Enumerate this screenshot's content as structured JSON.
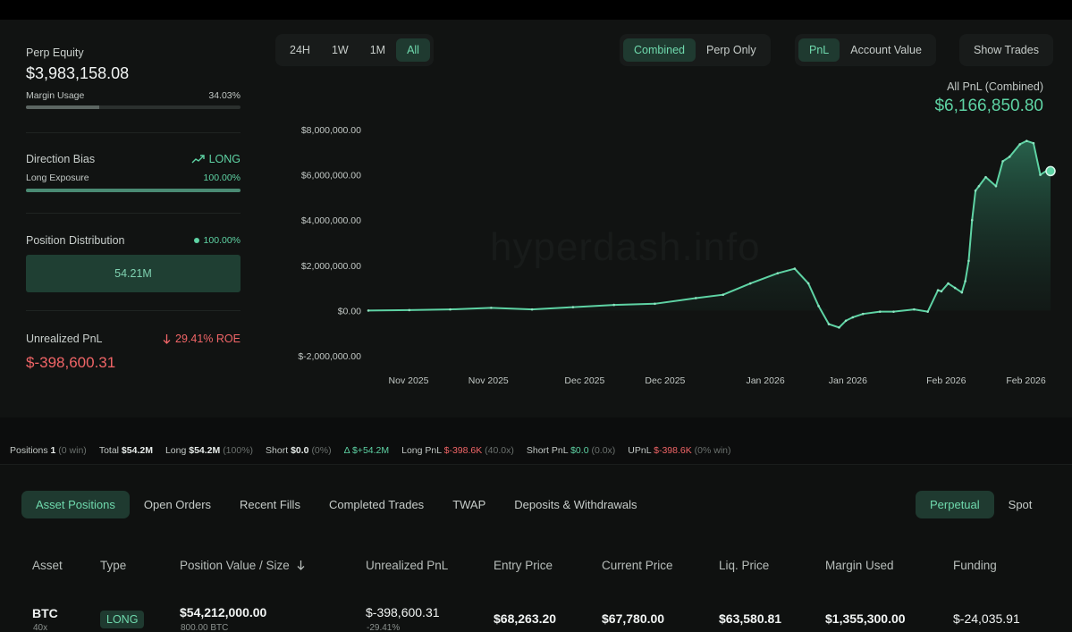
{
  "sidebar": {
    "perp_equity_label": "Perp Equity",
    "perp_equity_value": "$3,983,158.08",
    "margin_usage_label": "Margin Usage",
    "margin_usage_value": "34.03%",
    "margin_usage_fraction": 0.3403,
    "direction_bias_label": "Direction Bias",
    "direction_bias_value": "LONG",
    "long_exposure_label": "Long Exposure",
    "long_exposure_value": "100.00%",
    "long_exposure_fraction": 1.0,
    "position_distribution_label": "Position Distribution",
    "position_distribution_value": "100.00%",
    "position_distribution_amount": "54.21M",
    "unrealized_pnl_label": "Unrealized PnL",
    "unrealized_pnl_roe": "29.41% ROE",
    "unrealized_pnl_value": "$-398,600.31"
  },
  "range_tabs": [
    "24H",
    "1W",
    "1M",
    "All"
  ],
  "range_active": "All",
  "mode_tabs": [
    "Combined",
    "Perp Only"
  ],
  "mode_active": "Combined",
  "metric_tabs": [
    "PnL",
    "Account Value"
  ],
  "metric_active": "PnL",
  "show_trades_label": "Show Trades",
  "chart_header": {
    "label": "All PnL (Combined)",
    "value": "$6,166,850.80"
  },
  "watermark": "hyperdash.info",
  "chart_data": {
    "type": "area",
    "y_tick_labels": [
      "$8,000,000.00",
      "$6,000,000.00",
      "$4,000,000.00",
      "$2,000,000.00",
      "$0.00",
      "$-2,000,000.00"
    ],
    "y_ticks": [
      8000000,
      6000000,
      4000000,
      2000000,
      0,
      -2000000
    ],
    "ylim": [
      -2000000,
      8000000
    ],
    "x_tick_labels": [
      "Nov 2025",
      "Nov 2025",
      "Dec 2025",
      "Dec 2025",
      "Jan 2026",
      "Jan 2026",
      "Feb 2026",
      "Feb 2026"
    ],
    "x_ticks": [
      0.059,
      0.176,
      0.317,
      0.435,
      0.582,
      0.703,
      0.847,
      0.964
    ],
    "series": [
      {
        "x": [
          0,
          0.06,
          0.12,
          0.18,
          0.24,
          0.3,
          0.36,
          0.42,
          0.48,
          0.52,
          0.56,
          0.6,
          0.625,
          0.645,
          0.66,
          0.675,
          0.69,
          0.7,
          0.71,
          0.725,
          0.75,
          0.77,
          0.8,
          0.82,
          0.835,
          0.84,
          0.85,
          0.86,
          0.87,
          0.875,
          0.88,
          0.885,
          0.89,
          0.895,
          0.905,
          0.92,
          0.93,
          0.94,
          0.955,
          0.965,
          0.975,
          0.985,
          0.995,
          1.0
        ],
        "values": [
          0,
          20000,
          50000,
          120000,
          50000,
          150000,
          250000,
          300000,
          550000,
          700000,
          1200000,
          1650000,
          1850000,
          1200000,
          200000,
          -600000,
          -750000,
          -450000,
          -300000,
          -150000,
          -50000,
          -50000,
          50000,
          -50000,
          900000,
          850000,
          1200000,
          1000000,
          800000,
          1300000,
          2200000,
          4000000,
          5300000,
          5500000,
          5900000,
          5500000,
          6600000,
          6800000,
          7350000,
          7500000,
          7400000,
          6000000,
          6200000,
          6166850
        ]
      }
    ]
  },
  "stats_bar": {
    "positions_label": "Positions",
    "positions_count": "1",
    "positions_note": "(0 win)",
    "total_label": "Total",
    "total_value": "$54.2M",
    "long_label": "Long",
    "long_value": "$54.2M",
    "long_pct": "(100%)",
    "short_label": "Short",
    "short_value": "$0.0",
    "short_pct": "(0%)",
    "delta_label": "Δ",
    "delta_value": "$+54.2M",
    "long_pnl_label": "Long PnL",
    "long_pnl_value": "$-398.6K",
    "long_pnl_note": "(40.0x)",
    "short_pnl_label": "Short PnL",
    "short_pnl_value": "$0.0",
    "short_pnl_note": "(0.0x)",
    "upnl_label": "UPnL",
    "upnl_value": "$-398.6K",
    "upnl_note": "(0% win)"
  },
  "sub_tabs": [
    "Asset Positions",
    "Open Orders",
    "Recent Fills",
    "Completed Trades",
    "TWAP",
    "Deposits & Withdrawals"
  ],
  "sub_tab_active": "Asset Positions",
  "market_tabs": [
    "Perpetual",
    "Spot"
  ],
  "market_active": "Perpetual",
  "table": {
    "headers": [
      "Asset",
      "Type",
      "Position Value / Size",
      "Unrealized PnL",
      "Entry Price",
      "Current Price",
      "Liq. Price",
      "Margin Used",
      "Funding"
    ],
    "sort_icon": "arrow-down-icon",
    "row": {
      "asset": "BTC",
      "leverage": "40x",
      "type": "LONG",
      "position_value": "$54,212,000.00",
      "position_size": "800.00 BTC",
      "unrealized_pnl": "$-398,600.31",
      "unrealized_pnl_pct": "-29.41%",
      "entry_price": "$68,263.20",
      "current_price": "$67,780.00",
      "liq_price": "$63,580.81",
      "margin_used": "$1,355,300.00",
      "funding": "$-24,035.91"
    }
  },
  "colors": {
    "accent": "#5ed3a4",
    "negative": "#f06567",
    "background": "#111312"
  }
}
